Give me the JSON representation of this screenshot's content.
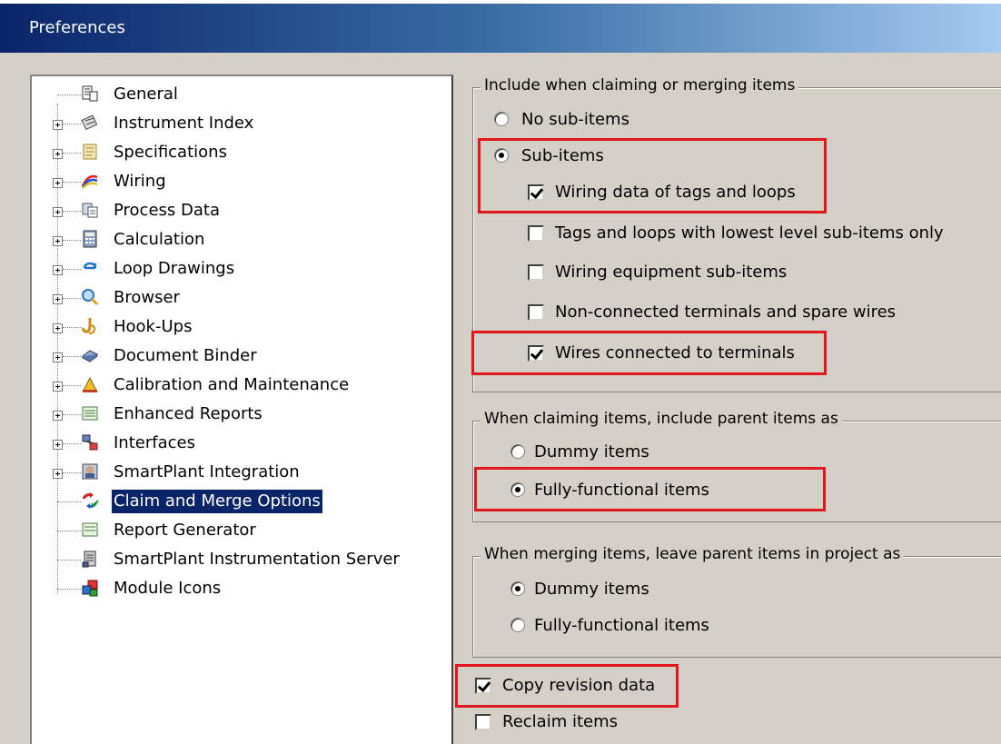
{
  "window": {
    "title": "Preferences"
  },
  "tree": {
    "items": [
      {
        "label": "General",
        "icon": "general-icon",
        "expandable": false,
        "selected": false
      },
      {
        "label": "Instrument Index",
        "icon": "instrument-index-icon",
        "expandable": true,
        "selected": false
      },
      {
        "label": "Specifications",
        "icon": "specifications-icon",
        "expandable": true,
        "selected": false
      },
      {
        "label": "Wiring",
        "icon": "wiring-icon",
        "expandable": true,
        "selected": false
      },
      {
        "label": "Process Data",
        "icon": "process-data-icon",
        "expandable": true,
        "selected": false
      },
      {
        "label": "Calculation",
        "icon": "calculator-icon",
        "expandable": true,
        "selected": false
      },
      {
        "label": "Loop Drawings",
        "icon": "loop-drawings-icon",
        "expandable": true,
        "selected": false
      },
      {
        "label": "Browser",
        "icon": "magnifier-icon",
        "expandable": true,
        "selected": false
      },
      {
        "label": "Hook-Ups",
        "icon": "hook-icon",
        "expandable": true,
        "selected": false
      },
      {
        "label": "Document Binder",
        "icon": "binder-icon",
        "expandable": true,
        "selected": false
      },
      {
        "label": "Calibration and Maintenance",
        "icon": "calibration-icon",
        "expandable": true,
        "selected": false
      },
      {
        "label": "Enhanced Reports",
        "icon": "report-icon",
        "expandable": true,
        "selected": false
      },
      {
        "label": "Interfaces",
        "icon": "interfaces-icon",
        "expandable": true,
        "selected": false
      },
      {
        "label": "SmartPlant Integration",
        "icon": "smartplant-integration-icon",
        "expandable": true,
        "selected": false
      },
      {
        "label": "Claim and Merge Options",
        "icon": "claim-merge-icon",
        "expandable": false,
        "selected": true
      },
      {
        "label": "Report Generator",
        "icon": "report-generator-icon",
        "expandable": false,
        "selected": false
      },
      {
        "label": "SmartPlant Instrumentation Server",
        "icon": "server-icon",
        "expandable": false,
        "selected": false
      },
      {
        "label": "Module Icons",
        "icon": "module-icons-icon",
        "expandable": false,
        "selected": false
      }
    ]
  },
  "include_group": {
    "title": "Include when claiming or merging items",
    "no_sub_items": "No sub-items",
    "sub_items": "Sub-items",
    "wiring_data": "Wiring data of tags and loops",
    "lowest_level": "Tags and loops with lowest level sub-items only",
    "wiring_equipment": "Wiring equipment sub-items",
    "non_connected": "Non-connected terminals and spare wires",
    "wires_connected": "Wires connected to terminals"
  },
  "claim_group": {
    "title": "When claiming items, include parent items as",
    "dummy": "Dummy items",
    "fully": "Fully-functional items"
  },
  "merge_group": {
    "title": "When merging items, leave parent items in project as",
    "dummy": "Dummy items",
    "fully": "Fully-functional items"
  },
  "options": {
    "copy_revision": "Copy revision data",
    "reclaim": "Reclaim items"
  },
  "colors": {
    "highlight": "#e2171b",
    "selection": "#0a246a",
    "dialog": "#d4d0c8"
  }
}
